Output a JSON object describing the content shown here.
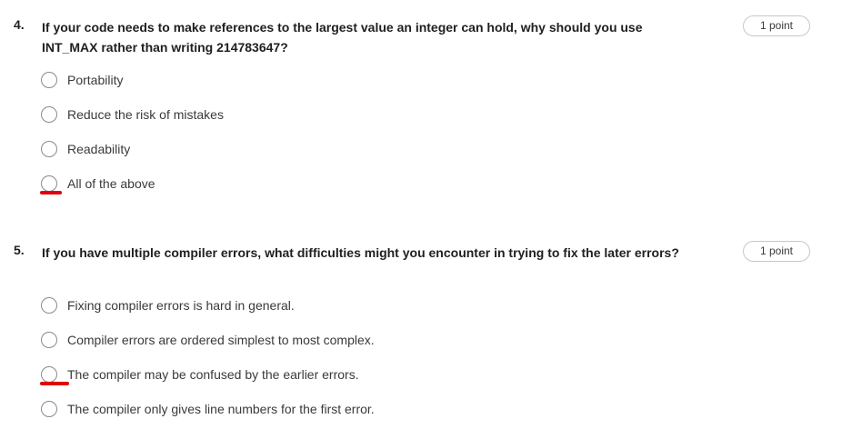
{
  "questions": [
    {
      "number": "4.",
      "text": "If your code needs to make references to the largest value an integer can hold, why should you use INT_MAX rather than writing 214783647?",
      "points": "1 point",
      "options": [
        {
          "label": "Portability"
        },
        {
          "label": "Reduce the risk of mistakes"
        },
        {
          "label": "Readability"
        },
        {
          "label": "All of the above"
        }
      ]
    },
    {
      "number": "5.",
      "text": "If you have multiple compiler errors, what difficulties might you encounter in trying to fix the later errors?",
      "points": "1 point",
      "options": [
        {
          "label": "Fixing compiler errors is hard in general."
        },
        {
          "label": "Compiler errors are ordered simplest to most complex."
        },
        {
          "label": "The compiler may be confused by the earlier errors."
        },
        {
          "label": "The compiler only gives line numbers for the first error."
        }
      ]
    }
  ],
  "colors": {
    "annotation": "#e3000f",
    "radio_border": "#8a8a8a",
    "badge_border": "#c8c8c8"
  }
}
